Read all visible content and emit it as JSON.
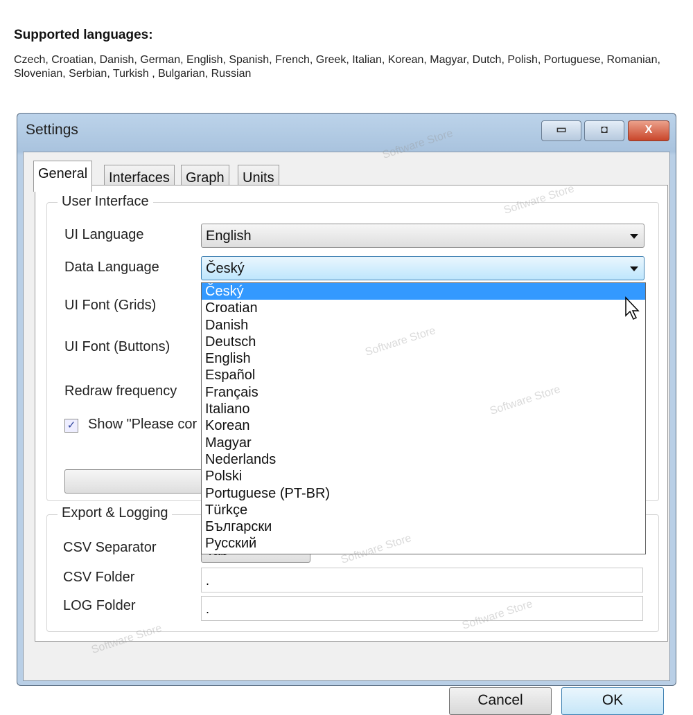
{
  "heading": "Supported languages:",
  "languages_text": "Czech, Croatian, Danish, German, English, Spanish, French, Greek, Italian, Korean, Magyar, Dutch, Polish, Portuguese, Romanian, Slovenian, Serbian, Turkish , Bulgarian, Russian",
  "dialog": {
    "title": "Settings",
    "minimize": "▭",
    "maximize": "◘",
    "close": "X",
    "tabs": [
      "General",
      "Interfaces",
      "Graph",
      "Units"
    ],
    "user_interface": {
      "label": "User Interface",
      "ui_language_label": "UI Language",
      "ui_language_value": "English",
      "data_language_label": "Data Language",
      "data_language_value": "Český",
      "ui_font_grids_label": "UI Font (Grids)",
      "ui_font_buttons_label": "UI Font (Buttons)",
      "redraw_label": "Redraw frequency",
      "show_checkbox_label": "Show \"Please cor",
      "show_checked": true
    },
    "dropdown_options": [
      "Český",
      "Croatian",
      "Danish",
      "Deutsch",
      "English",
      "Español",
      "Français",
      "Italiano",
      "Korean",
      "Magyar",
      "Nederlands",
      "Polski",
      "Portuguese (PT-BR)",
      "Türkçe",
      "Български",
      "Русский"
    ],
    "export": {
      "label": "Export & Logging",
      "csv_separator_label": "CSV Separator",
      "csv_separator_value": "Tab",
      "csv_folder_label": "CSV Folder",
      "csv_folder_value": ".",
      "log_folder_label": "LOG Folder",
      "log_folder_value": "."
    },
    "cancel": "Cancel",
    "ok": "OK"
  },
  "watermark": "Software Store",
  "colors": {
    "selection": "#3399ff",
    "close_button": "#d9573a"
  }
}
